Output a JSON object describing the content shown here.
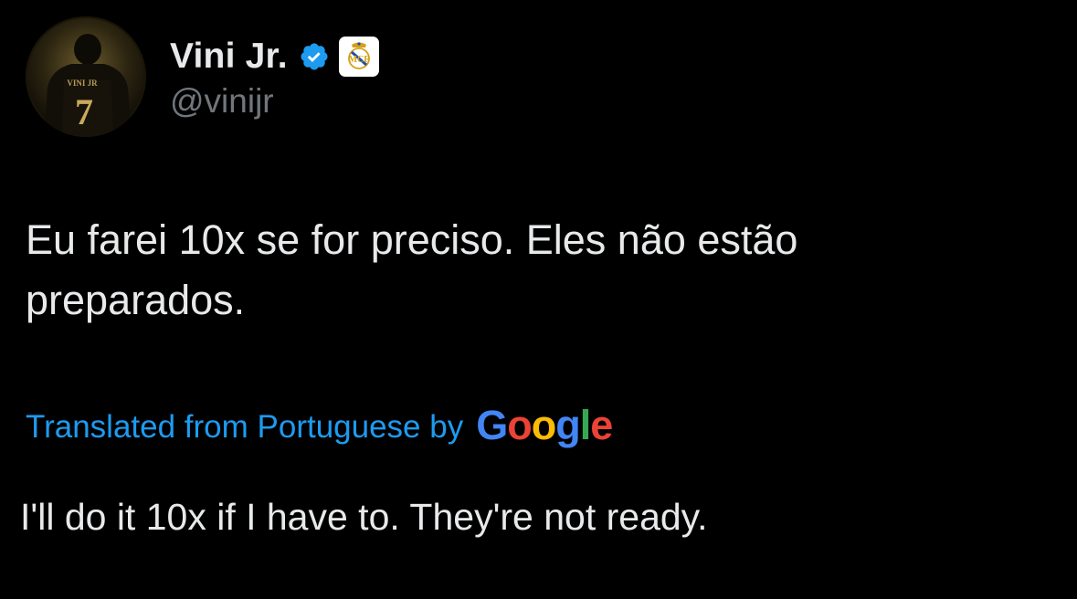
{
  "user": {
    "display_name": "Vini Jr.",
    "handle": "@vinijr",
    "avatar_jersey_text": "VINI JR",
    "avatar_jersey_number": "7",
    "verified_icon": "verified-badge-icon",
    "affiliation_icon": "real-madrid-crest-icon"
  },
  "tweet": {
    "text": "Eu farei 10x se for preciso. Eles não estão\npreparados.",
    "translated_label": "Translated from Portuguese by",
    "translation_provider": {
      "G": "G",
      "o1": "o",
      "o2": "o",
      "g": "g",
      "l": "l",
      "e": "e"
    },
    "translation": "I'll do it 10x if I have to. They're not ready."
  },
  "colors": {
    "background": "#000000",
    "primary_text": "#e7e9ea",
    "secondary_text": "#71767b",
    "link": "#1d9bf0",
    "verified": "#1d9bf0"
  }
}
